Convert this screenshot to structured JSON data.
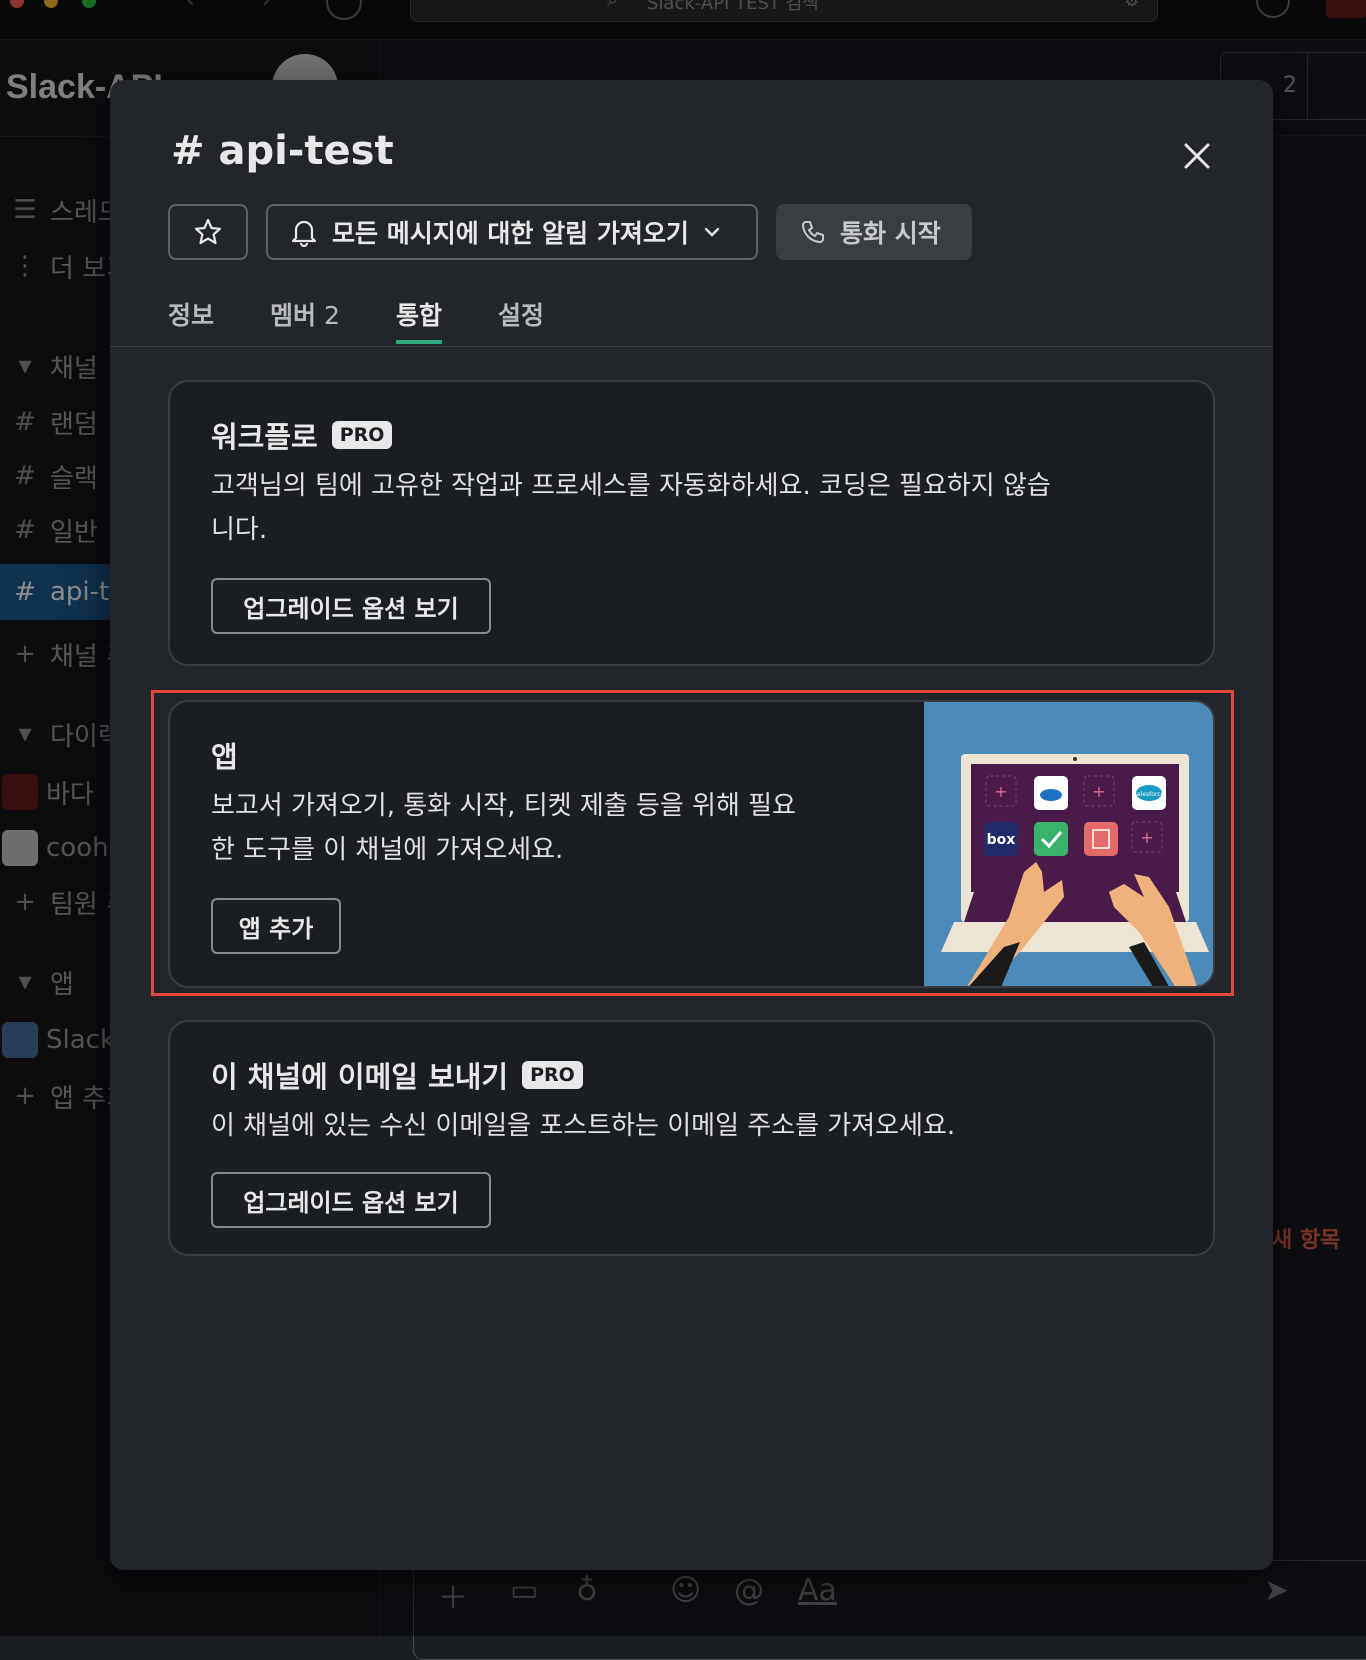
{
  "topbar": {
    "search_placeholder": "Slack-API TEST 검색"
  },
  "sidebar": {
    "workspace_name": "Slack-API",
    "items": [
      {
        "icon": "threads-icon",
        "label": "스레드"
      },
      {
        "icon": "more-icon",
        "label": "더 보기"
      },
      {
        "icon": "caret-down-icon",
        "label": "채널"
      },
      {
        "icon": "hash-icon",
        "label": "랜덤"
      },
      {
        "icon": "hash-icon",
        "label": "슬랙"
      },
      {
        "icon": "hash-icon",
        "label": "일반"
      },
      {
        "icon": "hash-icon",
        "label": "api-test"
      },
      {
        "icon": "plus-icon",
        "label": "채널 추가"
      },
      {
        "icon": "caret-down-icon",
        "label": "다이렉트 메시지"
      },
      {
        "icon": "avatar-icon",
        "label": "바다"
      },
      {
        "icon": "avatar-icon",
        "label": "cooh"
      },
      {
        "icon": "plus-icon",
        "label": "팀원 추가"
      },
      {
        "icon": "caret-down-icon",
        "label": "앱"
      },
      {
        "icon": "avatar-icon",
        "label": "Slack"
      },
      {
        "icon": "plus-icon",
        "label": "앱 추가"
      }
    ]
  },
  "channel": {
    "member_count": "2",
    "new_items_label": "새 항목"
  },
  "modal": {
    "title_hash": "#",
    "title": "api-test",
    "notify_label": "모든 메시지에 대한 알림 가져오기",
    "call_label": "통화 시작",
    "tabs": [
      {
        "label": "정보",
        "count": ""
      },
      {
        "label": "멤버",
        "count": "2"
      },
      {
        "label": "통합",
        "count": ""
      },
      {
        "label": "설정",
        "count": ""
      }
    ],
    "active_tab": "통합",
    "cards": {
      "workflow": {
        "title": "워크플로",
        "badge": "PRO",
        "desc_line1": "고객님의 팀에 고유한 작업과 프로세스를 자동화하세요. 코딩은 필요하지 않습",
        "desc_line2": "니다.",
        "button": "업그레이드 옵션 보기"
      },
      "apps": {
        "title": "앱",
        "desc_line1": "보고서 가져오기, 통화 시작, 티켓 제출 등을 위해 필요",
        "desc_line2": "한 도구를 이 채널에 가져오세요.",
        "button": "앱 추가",
        "illustration_labels": {
          "box": "box",
          "salesforce": "salesforce"
        }
      },
      "email": {
        "title": "이 채널에 이메일 보내기",
        "badge": "PRO",
        "desc": "이 채널에 있는 수신 이메일을 포스트하는 이메일 주소를 가져오세요.",
        "button": "업그레이드 옵션 보기"
      }
    }
  },
  "colors": {
    "accent_tab": "#2bac76",
    "highlight": "#e5483a",
    "sidebar_active": "#1d5a8e"
  }
}
